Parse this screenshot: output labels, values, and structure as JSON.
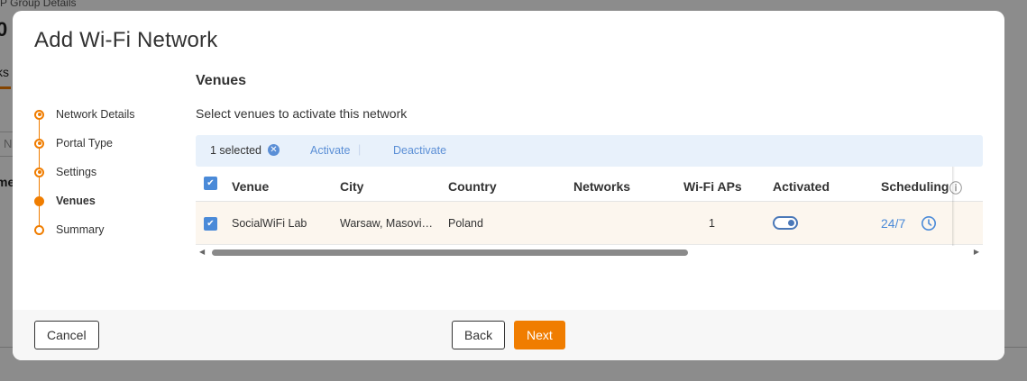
{
  "background": {
    "breadcrumb": "P Group Details",
    "title": "0",
    "tab": "ks (",
    "input_placeholder": "N",
    "column": "me"
  },
  "modal": {
    "title": "Add Wi-Fi Network"
  },
  "steps": [
    {
      "label": "Network Details",
      "state": "done"
    },
    {
      "label": "Portal Type",
      "state": "done"
    },
    {
      "label": "Settings",
      "state": "done"
    },
    {
      "label": "Venues",
      "state": "current"
    },
    {
      "label": "Summary",
      "state": "pending"
    }
  ],
  "venues": {
    "title": "Venues",
    "subtitle": "Select venues to activate this network",
    "selection": {
      "count_text": "1 selected",
      "clear_icon": "close-circle-icon",
      "activate_label": "Activate",
      "separator": "|",
      "deactivate_label": "Deactivate"
    },
    "table": {
      "columns": [
        "Venue",
        "City",
        "Country",
        "Networks",
        "Wi-Fi APs",
        "Activated",
        "Scheduling"
      ],
      "rows": [
        {
          "selected": true,
          "venue": "SocialWiFi Lab",
          "city": "Warsaw, Masovi…",
          "country": "Poland",
          "networks": "",
          "wifi_aps": "1",
          "activated": true,
          "scheduling": "24/7",
          "scheduling_icon": "clock-icon"
        }
      ]
    }
  },
  "footer": {
    "cancel_label": "Cancel",
    "back_label": "Back",
    "next_label": "Next"
  },
  "colors": {
    "accent": "#f07d00",
    "link": "#4a8ad8",
    "selection_bar": "#e8f1fb",
    "row_highlight": "#fcf6ee"
  }
}
